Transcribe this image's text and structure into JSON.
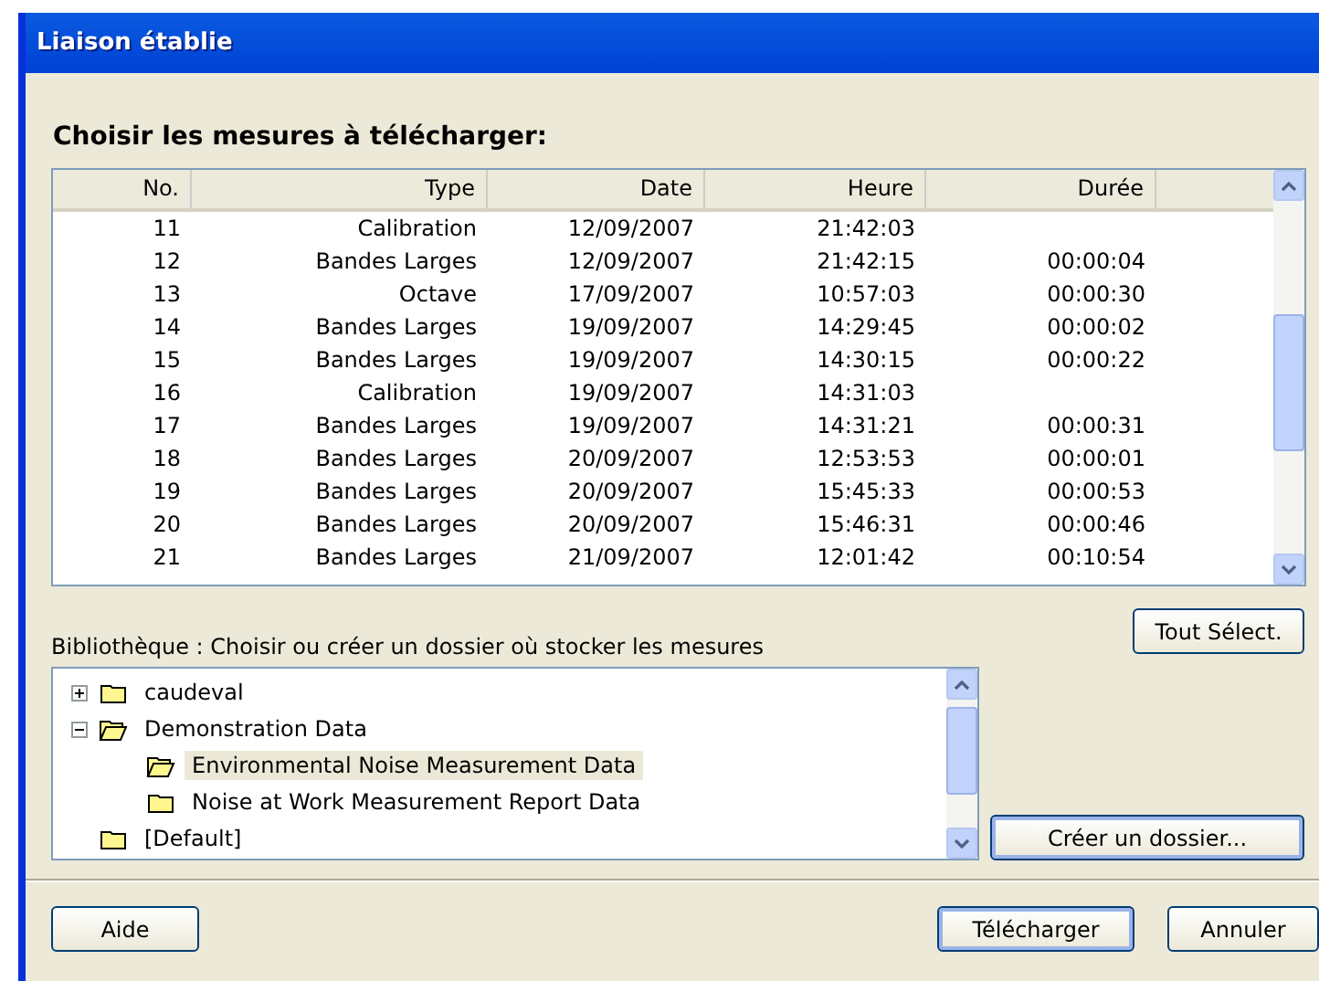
{
  "window": {
    "title": "Liaison établie"
  },
  "heading": "Choisir les mesures à télécharger:",
  "table": {
    "columns": [
      "No.",
      "Type",
      "Date",
      "Heure",
      "Durée"
    ],
    "rows": [
      [
        "11",
        "Calibration",
        "12/09/2007",
        "21:42:03",
        ""
      ],
      [
        "12",
        "Bandes Larges",
        "12/09/2007",
        "21:42:15",
        "00:00:04"
      ],
      [
        "13",
        "Octave",
        "17/09/2007",
        "10:57:03",
        "00:00:30"
      ],
      [
        "14",
        "Bandes Larges",
        "19/09/2007",
        "14:29:45",
        "00:00:02"
      ],
      [
        "15",
        "Bandes Larges",
        "19/09/2007",
        "14:30:15",
        "00:00:22"
      ],
      [
        "16",
        "Calibration",
        "19/09/2007",
        "14:31:03",
        ""
      ],
      [
        "17",
        "Bandes Larges",
        "19/09/2007",
        "14:31:21",
        "00:00:31"
      ],
      [
        "18",
        "Bandes Larges",
        "20/09/2007",
        "12:53:53",
        "00:00:01"
      ],
      [
        "19",
        "Bandes Larges",
        "20/09/2007",
        "15:45:33",
        "00:00:53"
      ],
      [
        "20",
        "Bandes Larges",
        "20/09/2007",
        "15:46:31",
        "00:00:46"
      ],
      [
        "21",
        "Bandes Larges",
        "21/09/2007",
        "12:01:42",
        "00:10:54"
      ]
    ]
  },
  "library": {
    "label": "Bibliothèque : Choisir ou créer un dossier où stocker les mesures",
    "tree": [
      {
        "label": "caudeval",
        "expanded": false,
        "selected": false
      },
      {
        "label": "Demonstration Data",
        "expanded": true,
        "selected": false,
        "children": [
          {
            "label": "Environmental Noise Measurement Data",
            "selected": true
          },
          {
            "label": "Noise at Work Measurement Report Data",
            "selected": false
          }
        ]
      },
      {
        "label": "[Default]",
        "selected": false
      }
    ]
  },
  "select_all_button": "Tout Sélect.",
  "create_folder_button": "Créer un dossier...",
  "buttons": [
    {
      "label": "Aide",
      "kind": "help"
    },
    {
      "label": "Télécharger",
      "kind": "primary"
    },
    {
      "label": "Annuler",
      "kind": "cancel"
    }
  ]
}
